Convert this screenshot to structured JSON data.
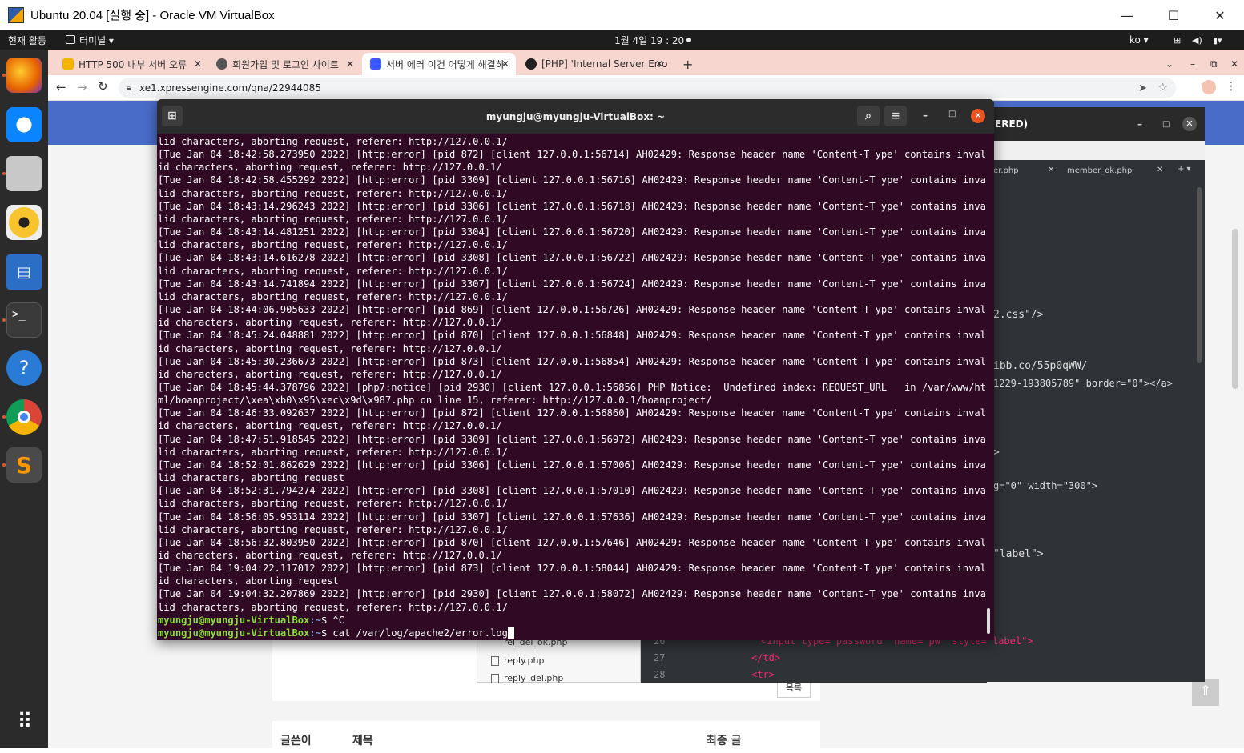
{
  "vbox": {
    "title": "Ubuntu 20.04 [실행 중] - Oracle VM VirtualBox",
    "min": "—",
    "max": "☐",
    "close": "✕"
  },
  "topbar": {
    "activities": "현재 활동",
    "app_menu": "터미널 ▾",
    "clock": "1월 4일  19 : 20",
    "lang": "ko ▾"
  },
  "dock": {
    "items": [
      "firefox-icon",
      "thunderbird-icon",
      "files-icon",
      "rhythmbox-icon",
      "libreoffice-writer-icon",
      "terminal-icon",
      "help-icon",
      "chrome-icon",
      "sublime-text-icon",
      "app-grid-icon"
    ]
  },
  "chrome": {
    "tabs": [
      {
        "label": "HTTP 500 내부 서버 오류",
        "color": "#f4b400"
      },
      {
        "label": "회원가입 및 로그인 사이트",
        "color": "#555555"
      },
      {
        "label": "서버 에러 이건 어떻게 해결하",
        "color": "#3d5afe"
      },
      {
        "label": "[PHP] 'Internal Server Erro",
        "color": "#222222"
      }
    ],
    "new_tab": "+",
    "url": "xe1.xpressengine.com/qna/22944085"
  },
  "terminal": {
    "title": "myungju@myungju-VirtualBox: ~",
    "lines": [
      "lid characters, aborting request, referer: http://127.0.0.1/",
      "[Tue Jan 04 18:42:58.273950 2022] [http:error] [pid 872] [client 127.0.0.1:56714] AH02429: Response header name 'Content-T ype' contains inval",
      "id characters, aborting request, referer: http://127.0.0.1/",
      "[Tue Jan 04 18:42:58.455292 2022] [http:error] [pid 3309] [client 127.0.0.1:56716] AH02429: Response header name 'Content-T ype' contains inva",
      "lid characters, aborting request, referer: http://127.0.0.1/",
      "[Tue Jan 04 18:43:14.296243 2022] [http:error] [pid 3306] [client 127.0.0.1:56718] AH02429: Response header name 'Content-T ype' contains inva",
      "lid characters, aborting request, referer: http://127.0.0.1/",
      "[Tue Jan 04 18:43:14.481251 2022] [http:error] [pid 3304] [client 127.0.0.1:56720] AH02429: Response header name 'Content-T ype' contains inva",
      "lid characters, aborting request, referer: http://127.0.0.1/",
      "[Tue Jan 04 18:43:14.616278 2022] [http:error] [pid 3308] [client 127.0.0.1:56722] AH02429: Response header name 'Content-T ype' contains inva",
      "lid characters, aborting request, referer: http://127.0.0.1/",
      "[Tue Jan 04 18:43:14.741894 2022] [http:error] [pid 3307] [client 127.0.0.1:56724] AH02429: Response header name 'Content-T ype' contains inva",
      "lid characters, aborting request, referer: http://127.0.0.1/",
      "[Tue Jan 04 18:44:06.905633 2022] [http:error] [pid 869] [client 127.0.0.1:56726] AH02429: Response header name 'Content-T ype' contains inval",
      "id characters, aborting request, referer: http://127.0.0.1/",
      "[Tue Jan 04 18:45:24.048881 2022] [http:error] [pid 870] [client 127.0.0.1:56848] AH02429: Response header name 'Content-T ype' contains inval",
      "id characters, aborting request, referer: http://127.0.0.1/",
      "[Tue Jan 04 18:45:30.236673 2022] [http:error] [pid 873] [client 127.0.0.1:56854] AH02429: Response header name 'Content-T ype' contains inval",
      "id characters, aborting request, referer: http://127.0.0.1/",
      "[Tue Jan 04 18:45:44.378796 2022] [php7:notice] [pid 2930] [client 127.0.0.1:56856] PHP Notice:  Undefined index: REQUEST_URL   in /var/www/ht",
      "ml/boanproject/\\xea\\xb0\\x95\\xec\\x9d\\x987.php on line 15, referer: http://127.0.0.1/boanproject/",
      "[Tue Jan 04 18:46:33.092637 2022] [http:error] [pid 872] [client 127.0.0.1:56860] AH02429: Response header name 'Content-T ype' contains inval",
      "id characters, aborting request, referer: http://127.0.0.1/",
      "[Tue Jan 04 18:47:51.918545 2022] [http:error] [pid 3309] [client 127.0.0.1:56972] AH02429: Response header name 'Content-T ype' contains inva",
      "lid characters, aborting request, referer: http://127.0.0.1/",
      "[Tue Jan 04 18:52:01.862629 2022] [http:error] [pid 3306] [client 127.0.0.1:57006] AH02429: Response header name 'Content-T ype' contains inva",
      "lid characters, aborting request",
      "[Tue Jan 04 18:52:31.794274 2022] [http:error] [pid 3308] [client 127.0.0.1:57010] AH02429: Response header name 'Content-T ype' contains inva",
      "lid characters, aborting request, referer: http://127.0.0.1/",
      "[Tue Jan 04 18:56:05.953114 2022] [http:error] [pid 3307] [client 127.0.0.1:57636] AH02429: Response header name 'Content-T ype' contains inva",
      "lid characters, aborting request, referer: http://127.0.0.1/",
      "[Tue Jan 04 18:56:32.803950 2022] [http:error] [pid 870] [client 127.0.0.1:57646] AH02429: Response header name 'Content-T ype' contains inval",
      "id characters, aborting request, referer: http://127.0.0.1/",
      "[Tue Jan 04 19:04:22.117012 2022] [http:error] [pid 873] [client 127.0.0.1:58044] AH02429: Response header name 'Content-T ype' contains inval",
      "id characters, aborting request",
      "[Tue Jan 04 19:04:32.207869 2022] [http:error] [pid 2930] [client 127.0.0.1:58072] AH02429: Response header name 'Content-T ype' contains inva",
      "lid characters, aborting request, referer: http://127.0.0.1/"
    ],
    "prompt_user": "myungju@myungju-VirtualBox",
    "prompt_path": ":~",
    "prompt_1_cmd": "$ ^C",
    "prompt_2_cmd": "$ cat /var/log/apache2/error.log"
  },
  "editor": {
    "title": "ERED)",
    "tabs": [
      "er.php",
      "member_ok.php"
    ],
    "snippets": [
      "2.css\"/>",
      "ibb.co/55p0qWW/",
      "1229-193805789\" border=\"0\"></a>",
      ">",
      "g=\"0\" width=\"300\">",
      "\"label\">"
    ],
    "bottom_lines": [
      {
        "no": "26",
        "code": "<input type=\"password\" name=\"pw\" style=\"label\">"
      },
      {
        "no": "27",
        "code": "</td>"
      },
      {
        "no": "28",
        "code": "<tr>"
      }
    ]
  },
  "files": [
    "rel_del_ok.php",
    "reply.php",
    "reply_del.php"
  ],
  "page": {
    "list_button": "목록",
    "col_author": "글쓴이",
    "col_title": "제목",
    "col_last": "최종 글"
  }
}
